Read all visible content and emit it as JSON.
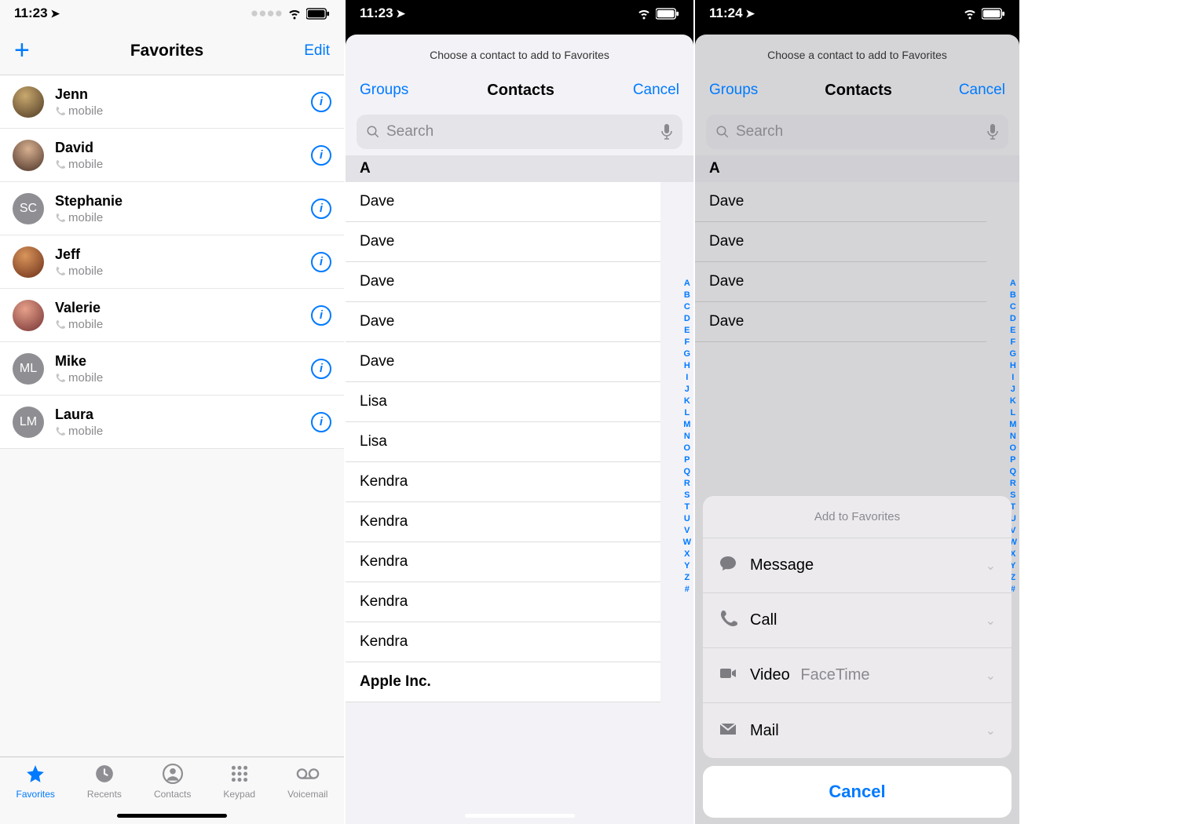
{
  "colors": {
    "accent": "#007aff",
    "grey": "#8e8e93"
  },
  "screen1": {
    "time": "11:23",
    "nav": {
      "title": "Favorites",
      "edit": "Edit"
    },
    "favorites": [
      {
        "name": "Jenn",
        "label": "mobile",
        "avatar": "photo",
        "initials": ""
      },
      {
        "name": "David",
        "label": "mobile",
        "avatar": "photo",
        "initials": ""
      },
      {
        "name": "Stephanie",
        "label": "mobile",
        "avatar": "initials",
        "initials": "SC"
      },
      {
        "name": "Jeff",
        "label": "mobile",
        "avatar": "photo",
        "initials": ""
      },
      {
        "name": "Valerie",
        "label": "mobile",
        "avatar": "photo",
        "initials": ""
      },
      {
        "name": "Mike",
        "label": "mobile",
        "avatar": "initials",
        "initials": "ML"
      },
      {
        "name": "Laura",
        "label": "mobile",
        "avatar": "initials",
        "initials": "LM"
      }
    ],
    "tabs": [
      {
        "label": "Favorites",
        "icon": "star",
        "active": true
      },
      {
        "label": "Recents",
        "icon": "clock",
        "active": false
      },
      {
        "label": "Contacts",
        "icon": "contact",
        "active": false
      },
      {
        "label": "Keypad",
        "icon": "keypad",
        "active": false
      },
      {
        "label": "Voicemail",
        "icon": "voicemail",
        "active": false
      }
    ]
  },
  "screen2": {
    "time": "11:23",
    "note": "Choose a contact to add to Favorites",
    "nav": {
      "groups": "Groups",
      "title": "Contacts",
      "cancel": "Cancel"
    },
    "search_placeholder": "Search",
    "section": "A",
    "contacts": [
      "Dave",
      "Dave",
      "Dave",
      "Dave",
      "Dave",
      "Lisa",
      "Lisa",
      "Kendra",
      "Kendra",
      "Kendra",
      "Kendra",
      "Kendra",
      "Apple Inc."
    ],
    "index": [
      "A",
      "B",
      "C",
      "D",
      "E",
      "F",
      "G",
      "H",
      "I",
      "J",
      "K",
      "L",
      "M",
      "N",
      "O",
      "P",
      "Q",
      "R",
      "S",
      "T",
      "U",
      "V",
      "W",
      "X",
      "Y",
      "Z",
      "#"
    ]
  },
  "screen3": {
    "time": "11:24",
    "note": "Choose a contact to add to Favorites",
    "nav": {
      "groups": "Groups",
      "title": "Contacts",
      "cancel": "Cancel"
    },
    "search_placeholder": "Search",
    "section": "A",
    "contacts": [
      "Dave",
      "Dave",
      "Dave",
      "Dave"
    ],
    "index": [
      "A",
      "B",
      "C",
      "D",
      "E",
      "F",
      "G",
      "H",
      "I",
      "J",
      "K",
      "L",
      "M",
      "N",
      "O",
      "P",
      "Q",
      "R",
      "S",
      "T",
      "U",
      "V",
      "W",
      "X",
      "Y",
      "Z",
      "#"
    ],
    "actionsheet": {
      "title": "Add to Favorites",
      "options": [
        {
          "label": "Message",
          "sub": "",
          "icon": "message"
        },
        {
          "label": "Call",
          "sub": "",
          "icon": "phone"
        },
        {
          "label": "Video",
          "sub": "FaceTime",
          "icon": "video"
        },
        {
          "label": "Mail",
          "sub": "",
          "icon": "mail"
        }
      ],
      "cancel": "Cancel"
    }
  }
}
